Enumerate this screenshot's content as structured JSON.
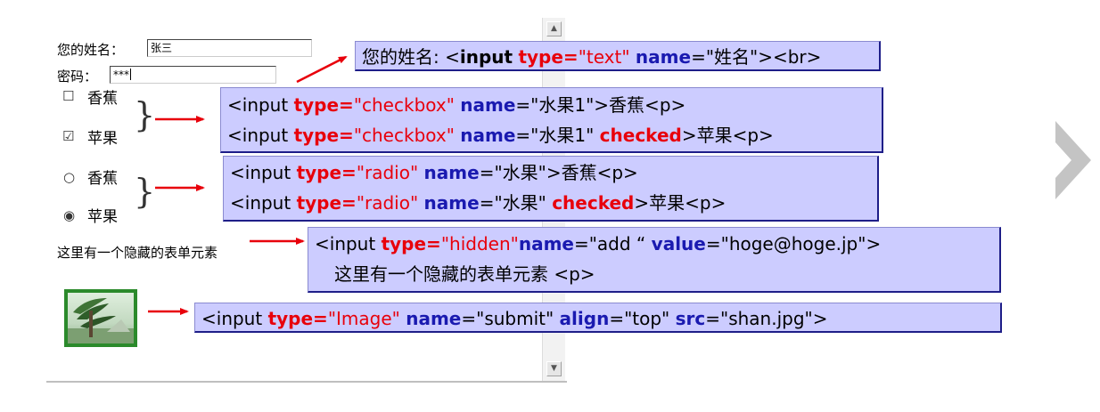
{
  "form": {
    "name_label": "您的姓名：",
    "name_value": "张三",
    "password_label": "密码：",
    "password_value": "***",
    "checkbox_banana_label": "香蕉",
    "checkbox_apple_label": "苹果",
    "radio_banana_label": "香蕉",
    "radio_apple_label": "苹果",
    "hidden_text": "这里有一个隐藏的表单元素",
    "checkbox_unchecked_glyph": "☐",
    "checkbox_checked_glyph": "☑",
    "radio_unchecked_glyph": "○",
    "radio_checked_glyph": "◉"
  },
  "scrollbar": {
    "up_glyph": "▲",
    "down_glyph": "▼"
  },
  "code": {
    "text_input": {
      "p1": "您的姓名: <",
      "tag": "input",
      "sp": " ",
      "type_kw": "type=",
      "type_val": "\"text\"",
      "sp2": " ",
      "name_kw": "name",
      "rest": "=\"姓名\"><br>"
    },
    "checkbox1": {
      "p1": "<input ",
      "type_kw": "type=",
      "type_val": "\"checkbox\"",
      "sp": " ",
      "name_kw": "name",
      "rest": "=\"水果1\">香蕉<p>"
    },
    "checkbox2": {
      "p1": "<input ",
      "type_kw": "type=",
      "type_val": "\"checkbox\"",
      "sp": " ",
      "name_kw": "name",
      "mid": "=\"水果1\" ",
      "checked_kw": "checked",
      "rest": ">苹果<p>"
    },
    "radio1": {
      "p1": "<input ",
      "type_kw": "type=",
      "type_val": "\"radio\"",
      "sp": " ",
      "name_kw": "name",
      "rest": "=\"水果\">香蕉<p>"
    },
    "radio2": {
      "p1": "<input ",
      "type_kw": "type=",
      "type_val": "\"radio\"",
      "sp": " ",
      "name_kw": "name",
      "mid": "=\"水果\" ",
      "checked_kw": "checked",
      "rest": ">苹果<p>"
    },
    "hidden1": {
      "p1": "<input ",
      "type_kw": "type=",
      "type_val": "\"hidden\"",
      "name_kw": "name",
      "mid": "=\"add “ ",
      "value_kw": "value",
      "rest": "=\"hoge@hoge.jp\">"
    },
    "hidden2": {
      "text": "这里有一个隐藏的表单元素 <p>"
    },
    "image": {
      "p1": "<input ",
      "type_kw": "type=",
      "type_val": "\"Image\"",
      "sp": " ",
      "name_kw": "name",
      "mid": "=\"submit\" ",
      "align_kw": "align",
      "mid2": "=\"top\" ",
      "src_kw": "src",
      "rest": "=\"shan.jpg\">"
    }
  },
  "colors": {
    "code_bg": "#ccccff",
    "keyword_red": "#e8000b",
    "keyword_blue": "#1a1ab0",
    "arrow_red": "#e8000b",
    "image_border": "#2b8a2b"
  }
}
